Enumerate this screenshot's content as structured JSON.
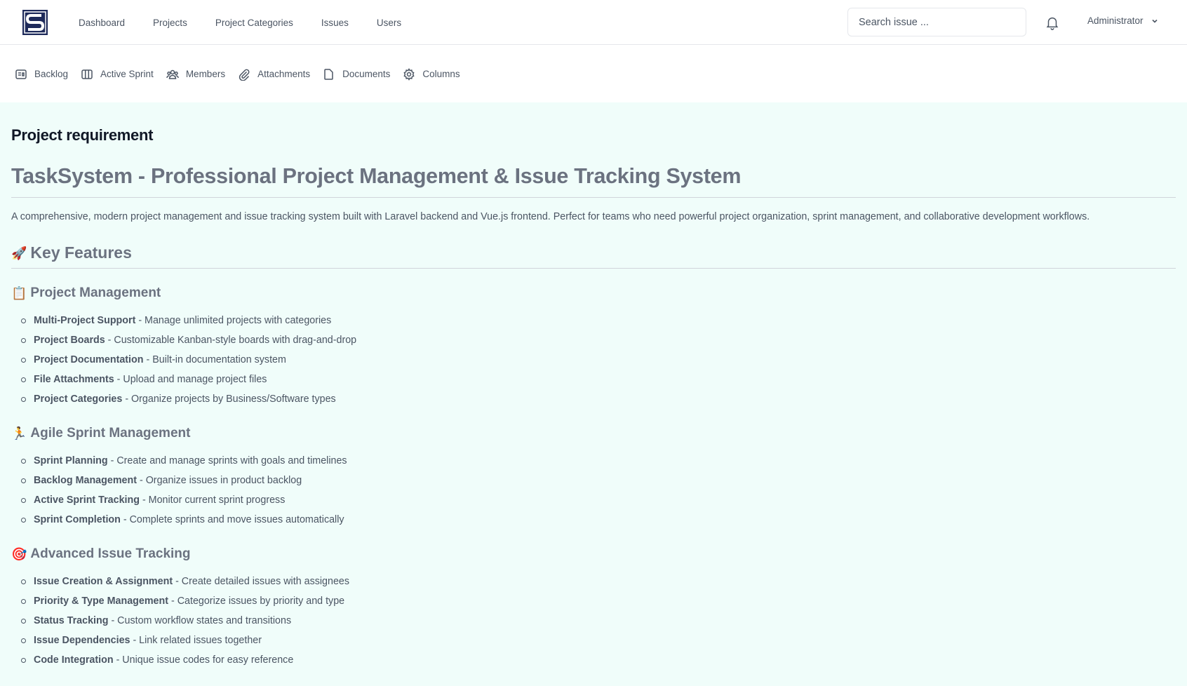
{
  "nav": {
    "items": [
      "Dashboard",
      "Projects",
      "Project Categories",
      "Issues",
      "Users"
    ]
  },
  "search": {
    "placeholder": "Search issue ..."
  },
  "user": {
    "name": "Administrator"
  },
  "subnav": {
    "items": [
      {
        "label": "Backlog",
        "icon": "backlog-icon"
      },
      {
        "label": "Active Sprint",
        "icon": "columns-board-icon"
      },
      {
        "label": "Members",
        "icon": "users-icon"
      },
      {
        "label": "Attachments",
        "icon": "paperclip-icon"
      },
      {
        "label": "Documents",
        "icon": "document-icon"
      },
      {
        "label": "Columns",
        "icon": "gear-icon"
      }
    ]
  },
  "page": {
    "title": "Project requirement"
  },
  "doc": {
    "h1": "TaskSystem - Professional Project Management & Issue Tracking System",
    "intro": "A comprehensive, modern project management and issue tracking system built with Laravel backend and Vue.js frontend. Perfect for teams who need powerful project organization, sprint management, and collaborative development workflows.",
    "h2": {
      "emoji": "🚀",
      "text": "Key Features"
    },
    "sections": [
      {
        "emoji": "📋",
        "title": "Project Management",
        "items": [
          {
            "bold": "Multi-Project Support",
            "text": " - Manage unlimited projects with categories"
          },
          {
            "bold": "Project Boards",
            "text": " - Customizable Kanban-style boards with drag-and-drop"
          },
          {
            "bold": "Project Documentation",
            "text": " - Built-in documentation system"
          },
          {
            "bold": "File Attachments",
            "text": " - Upload and manage project files"
          },
          {
            "bold": "Project Categories",
            "text": " - Organize projects by Business/Software types"
          }
        ]
      },
      {
        "emoji": "🏃",
        "title": "Agile Sprint Management",
        "items": [
          {
            "bold": "Sprint Planning",
            "text": " - Create and manage sprints with goals and timelines"
          },
          {
            "bold": "Backlog Management",
            "text": " - Organize issues in product backlog"
          },
          {
            "bold": "Active Sprint Tracking",
            "text": " - Monitor current sprint progress"
          },
          {
            "bold": "Sprint Completion",
            "text": " - Complete sprints and move issues automatically"
          }
        ]
      },
      {
        "emoji": "🎯",
        "title": "Advanced Issue Tracking",
        "items": [
          {
            "bold": "Issue Creation & Assignment",
            "text": " - Create detailed issues with assignees"
          },
          {
            "bold": "Priority & Type Management",
            "text": " - Categorize issues by priority and type"
          },
          {
            "bold": "Status Tracking",
            "text": " - Custom workflow states and transitions"
          },
          {
            "bold": "Issue Dependencies",
            "text": " - Link related issues together"
          },
          {
            "bold": "Code Integration",
            "text": " - Unique issue codes for easy reference"
          }
        ]
      }
    ]
  }
}
